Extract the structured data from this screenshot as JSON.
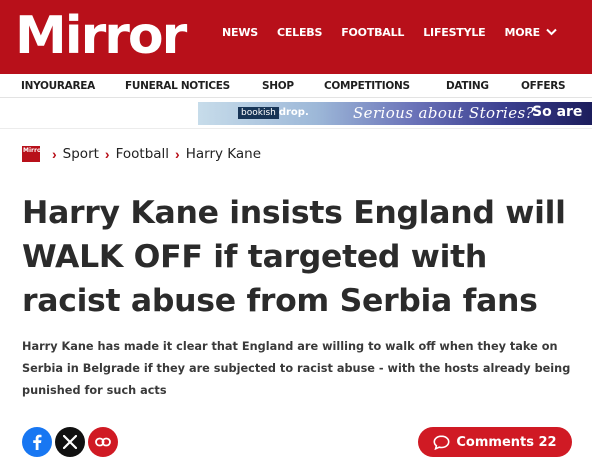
{
  "header": {
    "logo_text": "Mirror",
    "nav": [
      "NEWS",
      "CELEBS",
      "FOOTBALL",
      "LIFESTYLE",
      "MORE"
    ],
    "more_icon": "chevron-down-icon"
  },
  "subnav": [
    "INYOURAREA",
    "FUNERAL NOTICES",
    "SHOP",
    "COMPETITIONS",
    "DATING",
    "OFFERS"
  ],
  "ad": {
    "brand_prefix": "bookish",
    "brand_suffix": "drop.",
    "tagline": "Serious about Stories?",
    "cta": "So are"
  },
  "breadcrumb": {
    "logo_text": "Mirror",
    "items": [
      "Sport",
      "Football",
      "Harry Kane"
    ]
  },
  "article": {
    "headline": "Harry Kane insists England will WALK OFF if targeted with racist abuse from Serbia fans",
    "standfirst": "Harry Kane has made it clear that England are willing to walk off when they take on Serbia in Belgrade if they are subjected to racist abuse - with the hosts already being punished for such acts"
  },
  "share": {
    "icons": [
      "facebook-icon",
      "x-icon",
      "link-icon"
    ]
  },
  "comments": {
    "label": "Comments 22"
  },
  "colors": {
    "brand_red": "#b8101a",
    "button_red": "#d01a24",
    "facebook_blue": "#1877f2"
  }
}
